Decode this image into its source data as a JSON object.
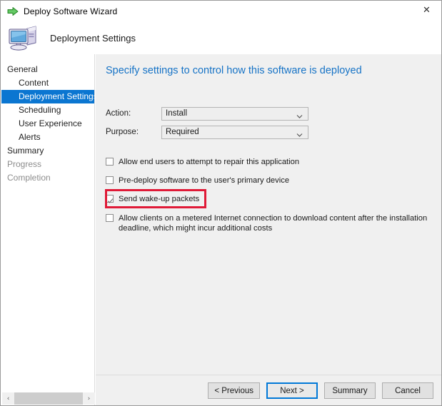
{
  "window": {
    "title": "Deploy Software Wizard",
    "title_icon": "green-arrow-icon",
    "close_label": "✕"
  },
  "header": {
    "title": "Deployment Settings",
    "icon": "computer-monitor-icon"
  },
  "sidebar": {
    "items": [
      {
        "label": "General",
        "level": "top",
        "state": "normal"
      },
      {
        "label": "Content",
        "level": "child",
        "state": "normal"
      },
      {
        "label": "Deployment Settings",
        "level": "child",
        "state": "selected"
      },
      {
        "label": "Scheduling",
        "level": "child",
        "state": "normal"
      },
      {
        "label": "User Experience",
        "level": "child",
        "state": "normal"
      },
      {
        "label": "Alerts",
        "level": "child",
        "state": "normal"
      },
      {
        "label": "Summary",
        "level": "top",
        "state": "normal"
      },
      {
        "label": "Progress",
        "level": "top",
        "state": "dim"
      },
      {
        "label": "Completion",
        "level": "top",
        "state": "dim"
      }
    ],
    "scroll_left": "‹",
    "scroll_right": "›"
  },
  "main": {
    "heading": "Specify settings to control how this software is deployed",
    "fields": [
      {
        "label": "Action:",
        "value": "Install"
      },
      {
        "label": "Purpose:",
        "value": "Required"
      }
    ],
    "checkboxes": [
      {
        "label": "Allow end users to attempt to repair this application",
        "checked": false
      },
      {
        "label": "Pre-deploy software to the user's primary device",
        "checked": false
      },
      {
        "label": "Send wake-up packets",
        "checked": true
      },
      {
        "label": "Allow clients on a metered Internet connection to download content after the installation deadline, which might incur additional costs",
        "checked": false
      }
    ]
  },
  "footer": {
    "buttons": [
      {
        "label": "< Previous",
        "focused": false
      },
      {
        "label": "Next >",
        "focused": true
      },
      {
        "label": "Summary",
        "focused": false
      },
      {
        "label": "Cancel",
        "focused": false
      }
    ]
  },
  "colors": {
    "accent_blue": "#0b76d1",
    "heading_blue": "#1673c6",
    "highlight_red": "#e01a37",
    "panel_gray": "#f0f0f0"
  }
}
